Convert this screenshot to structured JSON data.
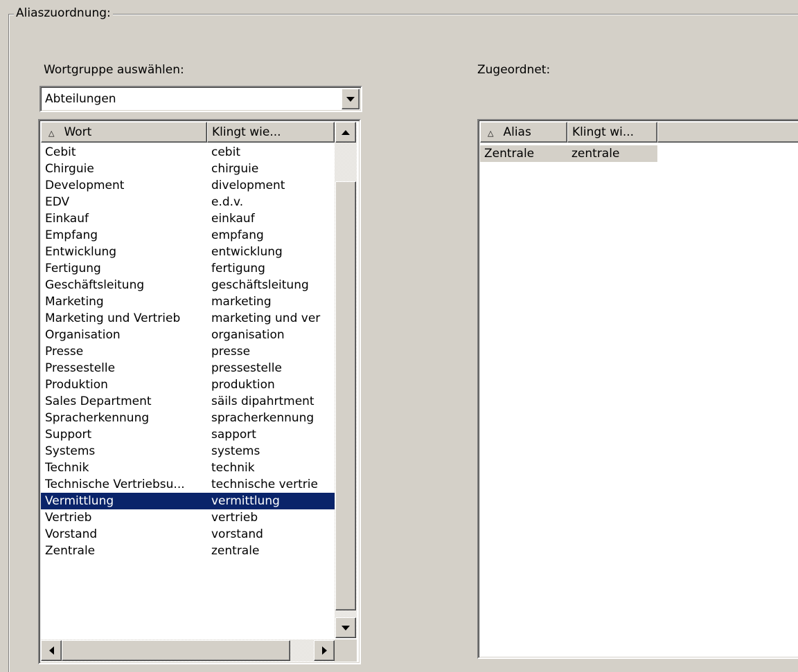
{
  "group": {
    "title": "Aliaszuordnung:"
  },
  "left": {
    "label": "Wortgruppe auswählen:",
    "combo_value": "Abteilungen",
    "columns": {
      "word": "Wort",
      "sounds_like": "Klingt wie..."
    },
    "rows": [
      {
        "word": "Cebit",
        "sounds_like": "cebit"
      },
      {
        "word": "Chirguie",
        "sounds_like": "chirguie"
      },
      {
        "word": "Development",
        "sounds_like": "divelopment"
      },
      {
        "word": "EDV",
        "sounds_like": "e.d.v."
      },
      {
        "word": "Einkauf",
        "sounds_like": "einkauf"
      },
      {
        "word": "Empfang",
        "sounds_like": "empfang"
      },
      {
        "word": "Entwicklung",
        "sounds_like": "entwicklung"
      },
      {
        "word": "Fertigung",
        "sounds_like": "fertigung"
      },
      {
        "word": "Geschäftsleitung",
        "sounds_like": "geschäftsleitung"
      },
      {
        "word": "Marketing",
        "sounds_like": "marketing"
      },
      {
        "word": "Marketing und Vertrieb",
        "sounds_like": "marketing und ver"
      },
      {
        "word": "Organisation",
        "sounds_like": "organisation"
      },
      {
        "word": "Presse",
        "sounds_like": "presse"
      },
      {
        "word": "Pressestelle",
        "sounds_like": "pressestelle"
      },
      {
        "word": "Produktion",
        "sounds_like": "produktion"
      },
      {
        "word": "Sales Department",
        "sounds_like": "säils dipahrtment"
      },
      {
        "word": "Spracherkennung",
        "sounds_like": "spracherkennung"
      },
      {
        "word": "Support",
        "sounds_like": "sapport"
      },
      {
        "word": "Systems",
        "sounds_like": "systems"
      },
      {
        "word": "Technik",
        "sounds_like": "technik"
      },
      {
        "word": "Technische Vertriebsu...",
        "sounds_like": "technische vertrie"
      },
      {
        "word": "Vermittlung",
        "sounds_like": "vermittlung",
        "selected": true
      },
      {
        "word": "Vertrieb",
        "sounds_like": "vertrieb"
      },
      {
        "word": "Vorstand",
        "sounds_like": "vorstand"
      },
      {
        "word": "Zentrale",
        "sounds_like": "zentrale"
      }
    ]
  },
  "right": {
    "label": "Zugeordnet:",
    "columns": {
      "alias": "Alias",
      "sounds_like": "Klingt wi..."
    },
    "rows": [
      {
        "alias": "Zentrale",
        "sounds_like": "zentrale"
      }
    ]
  },
  "icons": {
    "sort": "sort-ascending-icon"
  },
  "colors": {
    "selection": "#0a246a",
    "face": "#d4d0c8"
  }
}
